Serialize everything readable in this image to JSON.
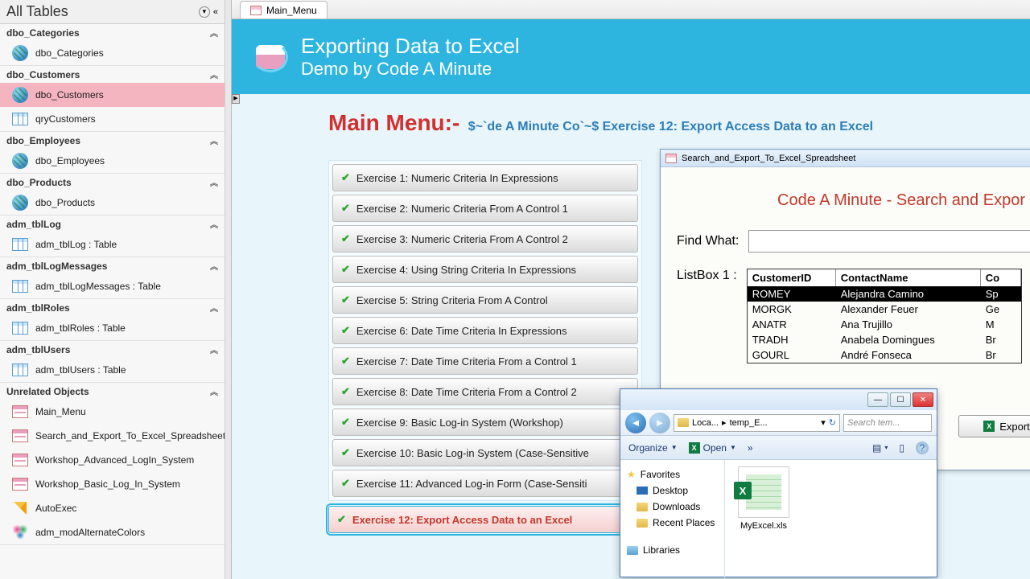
{
  "nav": {
    "title": "All Tables",
    "groups": [
      {
        "name": "dbo_Categories",
        "items": [
          {
            "label": "dbo_Categories",
            "icon": "globe"
          }
        ]
      },
      {
        "name": "dbo_Customers",
        "items": [
          {
            "label": "dbo_Customers",
            "icon": "globe",
            "selected": true
          },
          {
            "label": "qryCustomers",
            "icon": "table-blue"
          }
        ]
      },
      {
        "name": "dbo_Employees",
        "items": [
          {
            "label": "dbo_Employees",
            "icon": "globe"
          }
        ]
      },
      {
        "name": "dbo_Products",
        "items": [
          {
            "label": "dbo_Products",
            "icon": "globe"
          }
        ]
      },
      {
        "name": "adm_tblLog",
        "items": [
          {
            "label": "adm_tblLog : Table",
            "icon": "table-blue"
          }
        ]
      },
      {
        "name": "adm_tblLogMessages",
        "items": [
          {
            "label": "adm_tblLogMessages : Table",
            "icon": "table-blue"
          }
        ]
      },
      {
        "name": "adm_tblRoles",
        "items": [
          {
            "label": "adm_tblRoles : Table",
            "icon": "table-blue"
          }
        ]
      },
      {
        "name": "adm_tblUsers",
        "items": [
          {
            "label": "adm_tblUsers : Table",
            "icon": "table-blue"
          }
        ]
      }
    ],
    "unrelated_label": "Unrelated Objects",
    "unrelated": [
      {
        "label": "Main_Menu",
        "icon": "form"
      },
      {
        "label": "Search_and_Export_To_Excel_Spreadsheet",
        "icon": "form"
      },
      {
        "label": "Workshop_Advanced_LogIn_System",
        "icon": "form"
      },
      {
        "label": "Workshop_Basic_Log_In_System",
        "icon": "form"
      },
      {
        "label": "AutoExec",
        "icon": "caret"
      },
      {
        "label": "adm_modAlternateColors",
        "icon": "module"
      }
    ]
  },
  "tab": {
    "label": "Main_Menu"
  },
  "banner": {
    "title": "Exporting Data to Excel",
    "subtitle": "Demo by Code A Minute"
  },
  "main": {
    "heading": "Main Menu:-",
    "subheading": "$~`de A Minute Co`~$ Exercise 12: Export Access Data to an Excel",
    "exercises": [
      "Exercise 1: Numeric Criteria In Expressions",
      "Exercise 2: Numeric Criteria From A Control 1",
      "Exercise 3: Numeric Criteria From A Control 2",
      "Exercise 4: Using String Criteria In Expressions",
      "Exercise 5: String Criteria From A Control",
      "Exercise 6: Date Time Criteria In Expressions",
      "Exercise 7: Date Time Criteria From a Control 1",
      "Exercise 8: Date Time Criteria From a Control 2",
      "Exercise 9: Basic Log-in System (Workshop)",
      "Exercise 10: Basic Log-in System (Case-Sensitive",
      "Exercise 11: Advanced Log-in Form (Case-Sensiti"
    ],
    "active_exercise": "Exercise 12: Export Access Data to an Excel"
  },
  "subform": {
    "title": "Search_and_Export_To_Excel_Spreadsheet",
    "heading": "Code A Minute - Search and Expor",
    "find_label": "Find What:",
    "listbox_label": "ListBox 1 :",
    "columns": [
      "CustomerID",
      "ContactName",
      "Co"
    ],
    "rows": [
      {
        "a": "ROMEY",
        "b": "Alejandra Camino",
        "c": "Sp",
        "sel": true
      },
      {
        "a": "MORGK",
        "b": "Alexander Feuer",
        "c": "Ge"
      },
      {
        "a": "ANATR",
        "b": "Ana Trujillo",
        "c": "M"
      },
      {
        "a": "TRADH",
        "b": "Anabela Domingues",
        "c": "Br"
      },
      {
        "a": "GOURL",
        "b": "André Fonseca",
        "c": "Br"
      }
    ],
    "export_label": "Export"
  },
  "explorer": {
    "back": "◄",
    "fwd": "►",
    "path_parts": [
      "Loca...",
      "temp_E..."
    ],
    "search_placeholder": "Search tem...",
    "organize": "Organize",
    "open": "Open",
    "favorites": "Favorites",
    "desktop": "Desktop",
    "downloads": "Downloads",
    "recent": "Recent Places",
    "libraries": "Libraries",
    "file": "MyExcel.xls"
  }
}
